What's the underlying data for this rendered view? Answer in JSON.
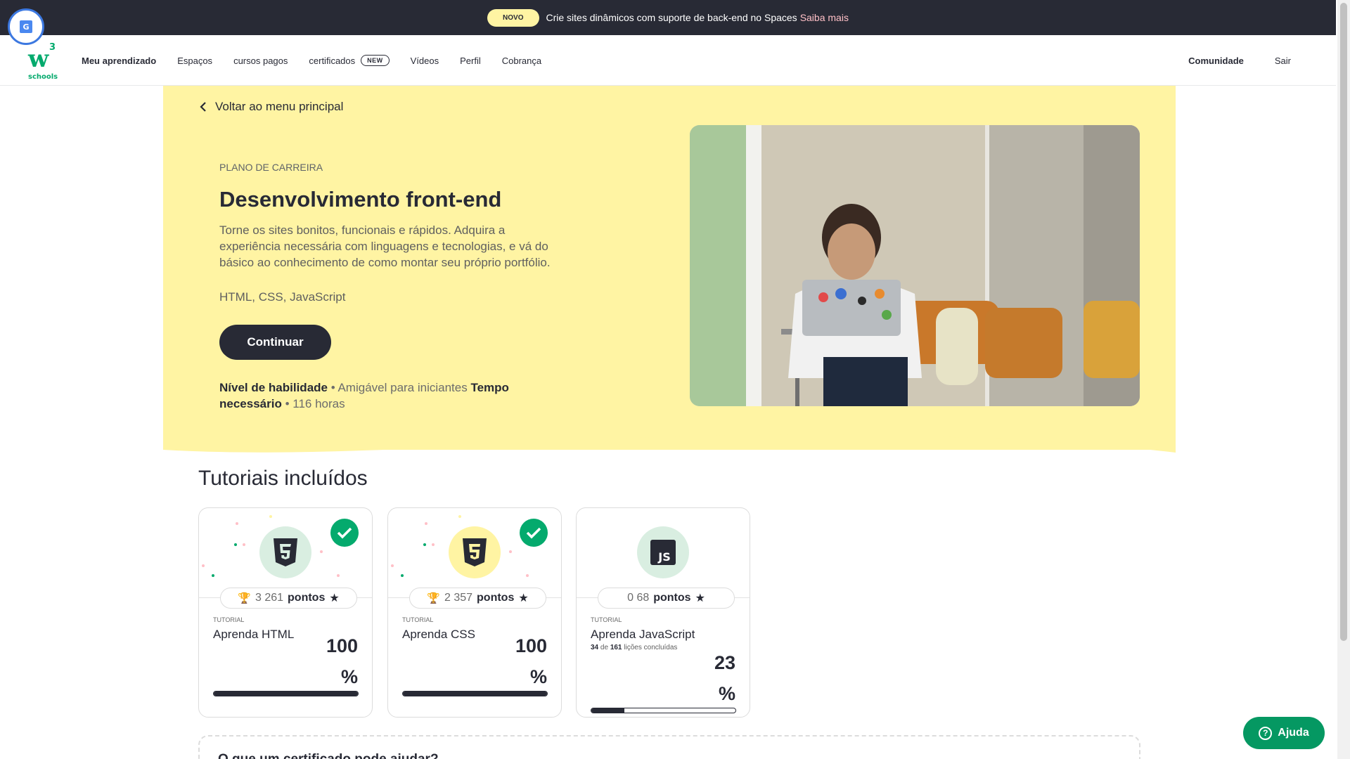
{
  "banner": {
    "pill": "NOVO",
    "message": "Crie sites dinâmicos com suporte de back-end no Spaces",
    "link": "Saiba mais"
  },
  "logo": {
    "mark": "w",
    "sup": "3",
    "text": "schools"
  },
  "nav": {
    "links": [
      "Meu aprendizado",
      "Espaços",
      "cursos pagos",
      "certificados",
      "Vídeos",
      "Perfil",
      "Cobrança"
    ],
    "new_badge": "NEW",
    "community": "Comunidade",
    "logout": "Sair"
  },
  "hero": {
    "back": "Voltar ao menu principal",
    "kicker": "PLANO DE CARREIRA",
    "title": "Desenvolvimento front-end",
    "description": "Torne os sites bonitos, funcionais e rápidos. Adquira a experiência necessária com linguagens e tecnologias, e vá do básico ao conhecimento de como montar seu próprio portfólio.",
    "techs": "HTML, CSS, JavaScript",
    "continue": "Continuar",
    "skill_label": "Nível de habilidade",
    "skill_value": "Amigável para iniciantes",
    "time_label": "Tempo necessário",
    "time_value": "116 horas"
  },
  "tutorials": {
    "title": "Tutoriais incluídos",
    "points_label": "pontos",
    "kind": "TUTORIAL",
    "items": [
      {
        "name": "Aprenda HTML",
        "points": "3 261",
        "percent": "100",
        "pct_sign": "%",
        "progress": 1.0,
        "completed": true,
        "icon": "html5-icon",
        "lessons_done": "",
        "lessons_total": "",
        "lessons_text": ""
      },
      {
        "name": "Aprenda CSS",
        "points": "2 357",
        "percent": "100",
        "pct_sign": "%",
        "progress": 1.0,
        "completed": true,
        "icon": "css3-icon",
        "lessons_done": "",
        "lessons_total": "",
        "lessons_text": ""
      },
      {
        "name": "Aprenda JavaScript",
        "points": "0 68",
        "percent": "23",
        "pct_sign": "%",
        "progress": 0.23,
        "completed": false,
        "icon": "js-icon",
        "lessons_done": "34",
        "lessons_total": "161",
        "lessons_of": "de",
        "lessons_text": "lições concluídas"
      }
    ]
  },
  "next_question": "O que um certificado pode ajudar?",
  "help": {
    "label": "Ajuda"
  },
  "colors": {
    "accent": "#04aa6d",
    "hero_bg": "#fff4a3",
    "dark": "#282a35",
    "help_bg": "#059862"
  }
}
